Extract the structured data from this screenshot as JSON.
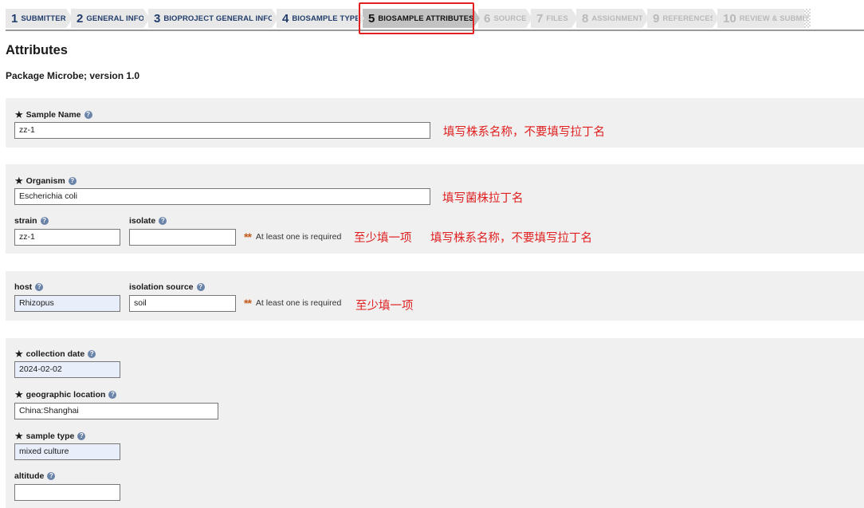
{
  "wizard": {
    "steps": [
      {
        "num": "1",
        "label": "SUBMITTER"
      },
      {
        "num": "2",
        "label": "GENERAL INFO"
      },
      {
        "num": "3",
        "label": "BIOPROJECT GENERAL INFO"
      },
      {
        "num": "4",
        "label": "BIOSAMPLE TYPE"
      },
      {
        "num": "5",
        "label": "BIOSAMPLE ATTRIBUTES"
      },
      {
        "num": "6",
        "label": "SOURCE"
      },
      {
        "num": "7",
        "label": "FILES"
      },
      {
        "num": "8",
        "label": "ASSIGNMENT"
      },
      {
        "num": "9",
        "label": "REFERENCES"
      },
      {
        "num": "10",
        "label": "REVIEW & SUBMIT"
      }
    ],
    "active_step": "5"
  },
  "page": {
    "title": "Attributes",
    "package": "Package Microbe; version 1.0"
  },
  "icons": {
    "required": "star-icon",
    "help": "help-icon",
    "help_glyph": "?",
    "required_glyph": "★",
    "either_glyph": "**"
  },
  "fields": {
    "sample_name": {
      "label": "Sample Name",
      "value": ""
    },
    "organism": {
      "label": "Organism",
      "value": "Escherichia coli"
    },
    "strain": {
      "label": "strain",
      "value": "zz-1"
    },
    "isolate": {
      "label": "isolate",
      "value": ""
    },
    "host": {
      "label": "host",
      "value": "Rhizopus"
    },
    "isolation_source": {
      "label": "isolation source",
      "value": "soil"
    },
    "collection_date": {
      "label": "collection date",
      "value": "2024-02-02"
    },
    "geo_loc": {
      "label": "geographic location",
      "value": "China:Shanghai"
    },
    "sample_type": {
      "label": "sample type",
      "value": "mixed culture"
    },
    "altitude": {
      "label": "altitude",
      "value": ""
    }
  },
  "sample_name_value": "zz-1",
  "required_note": "At least one is required",
  "annotations": {
    "sample_name": "填写株系名称，不要填写拉丁名",
    "organism": "填写菌株拉丁名",
    "strain_either": "至少填一项",
    "strain_name": "填写株系名称，不要填写拉丁名",
    "host_either": "至少填一项"
  },
  "colors": {
    "annotation": "#e02020",
    "highlight": "#e02020",
    "step_done": "#213d6c",
    "step_todo": "#b9b9b9",
    "required_stars": "#c45a1c",
    "prefilled_input": "#e8eefa"
  }
}
